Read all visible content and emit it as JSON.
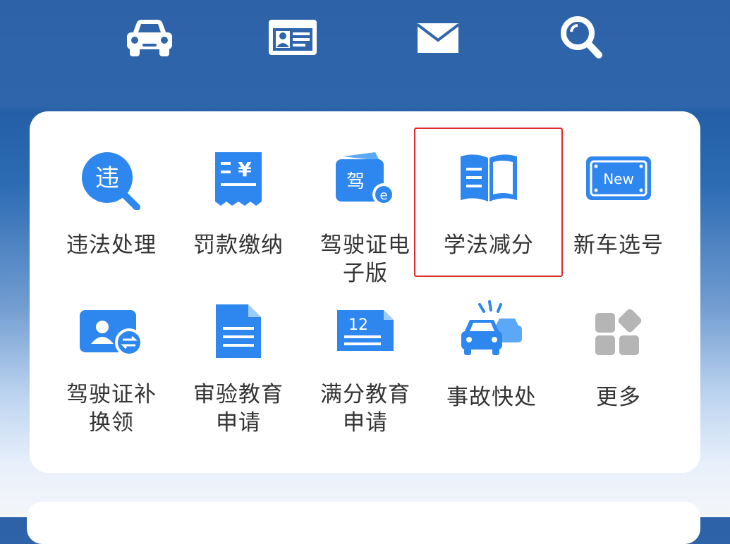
{
  "colors": {
    "header": "#2f66ab",
    "icon_blue": "#2e86ef",
    "icon_blue_light": "#5aa8f7",
    "highlight": "#e02a2a",
    "label": "#333333"
  },
  "top_nav": [
    {
      "icon": "car-icon"
    },
    {
      "icon": "id-card-icon"
    },
    {
      "icon": "mail-icon"
    },
    {
      "icon": "search-icon"
    }
  ],
  "services": [
    {
      "label": "违法处理",
      "icon": "violation-search-icon",
      "icon_text": "违"
    },
    {
      "label": "罚款缴纳",
      "icon": "fine-receipt-icon",
      "icon_text": "¥"
    },
    {
      "label": "驾驶证电子版",
      "icon": "e-license-icon",
      "icon_text": "驾"
    },
    {
      "label": "学法减分",
      "icon": "book-icon"
    },
    {
      "label": "新车选号",
      "icon": "new-plate-icon",
      "icon_text": "New"
    },
    {
      "label": "驾驶证补换领",
      "icon": "license-exchange-icon"
    },
    {
      "label": "审验教育申请",
      "icon": "document-icon"
    },
    {
      "label": "满分教育申请",
      "icon": "calendar-12-icon",
      "icon_text": "12"
    },
    {
      "label": "事故快处",
      "icon": "accident-icon"
    },
    {
      "label": "更多",
      "icon": "more-grid-icon"
    }
  ]
}
